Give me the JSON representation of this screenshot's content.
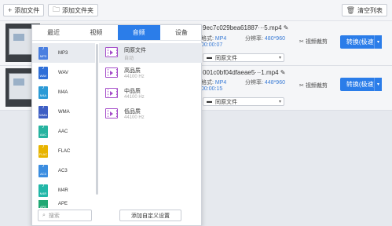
{
  "toolbar": {
    "add_file": "添加文件",
    "add_folder": "添加文件夹",
    "clear_list": "清空列表"
  },
  "files": [
    {
      "name": "9ec7c029bea61887···5.mp4",
      "format_label": "格式:",
      "format_value": "MP4",
      "res_label": "分辨率:",
      "res_value": "480*960",
      "duration": "00:00:07",
      "preset": "同原文件",
      "clip_label": "视频裁剪",
      "convert_label": "转换(极速)"
    },
    {
      "name": "001c0bf04dfaeae5···1.mp4",
      "format_label": "格式:",
      "format_value": "MP4",
      "res_label": "分辨率:",
      "res_value": "448*960",
      "duration": "00:00:15",
      "preset": "同原文件",
      "clip_label": "视频裁剪",
      "convert_label": "转换(极速)"
    }
  ],
  "panel": {
    "tabs": [
      "最近",
      "视频",
      "音频",
      "设备"
    ],
    "active_tab": "音频",
    "formats": [
      {
        "label": "MP3",
        "badge": "MP3",
        "color": "#4a7fe0"
      },
      {
        "label": "WAV",
        "badge": "WAV",
        "color": "#2f6fd8"
      },
      {
        "label": "M4A",
        "badge": "M4A",
        "color": "#2c9ad6"
      },
      {
        "label": "WMA",
        "badge": "WMA",
        "color": "#3e5fc4"
      },
      {
        "label": "AAC",
        "badge": "AAC",
        "color": "#27b3a0"
      },
      {
        "label": "FLAC",
        "badge": "FLAC",
        "color": "#e8b400"
      },
      {
        "label": "AC3",
        "badge": "AC3",
        "color": "#3b8de0"
      },
      {
        "label": "M4R",
        "badge": "M4R",
        "color": "#22b7a8"
      },
      {
        "label": "APE",
        "badge": "APE",
        "color": "#21a874"
      }
    ],
    "qualities": [
      {
        "title": "同原文件",
        "sub": "自动"
      },
      {
        "title": "高品质",
        "sub": "44100 Hz"
      },
      {
        "title": "中品质",
        "sub": "44100 Hz"
      },
      {
        "title": "低品质",
        "sub": "44100 Hz"
      }
    ],
    "search_placeholder": "搜索",
    "custom_settings": "添加自定义设置"
  }
}
